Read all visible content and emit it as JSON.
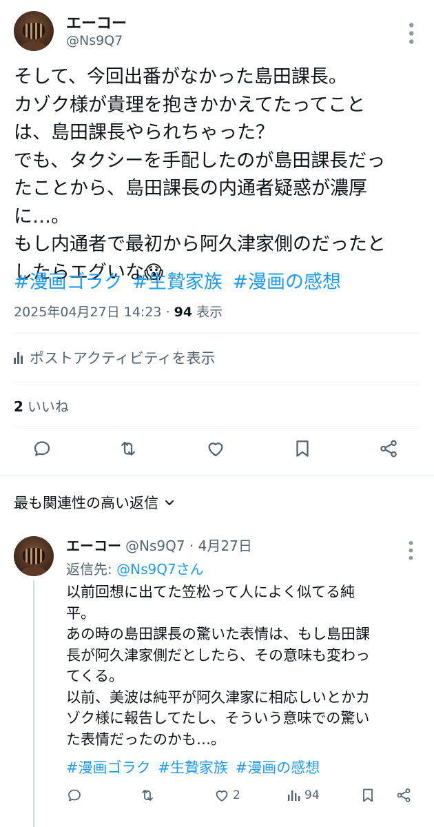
{
  "post": {
    "display_name": "エーコー",
    "handle": "@Ns9Q7",
    "text_lines": [
      "そして、今回出番がなかった島田課長。",
      "カゾク様が貴理を抱きかかえてたってこと",
      "は、島田課長やられちゃった？",
      "でも、タクシーを手配したのが島田課長だっ",
      "たことから、島田課長の内通者疑惑が濃厚",
      "に…。",
      "もし内通者で最初から阿久津家側のだったと",
      "したらエグいな😱"
    ],
    "hashtags": [
      "#漫画ゴラク",
      "#生贄家族",
      "#漫画の感想"
    ],
    "timestamp": "2025年04月27日 14:23",
    "separator": "·",
    "views_count": "94",
    "views_label": "表示",
    "activity_label": "ポストアクティビティを表示",
    "likes_count": "2",
    "likes_label": "いいね"
  },
  "replies_header": {
    "label": "最も関連性の高い返信"
  },
  "reply": {
    "display_name": "エーコー",
    "meta": "@Ns9Q7 · 4月27日",
    "reply_to_prefix": "返信先: ",
    "reply_to_handle": "@Ns9Q7さん",
    "text_lines": [
      "以前回想に出てた笠松って人によく似てる純",
      "平。",
      "あの時の島田課長の驚いた表情は、もし島田課",
      "長が阿久津家側だとしたら、その意味も変わっ",
      "てくる。",
      "以前、美波は純平が阿久津家に相応しいとかカ",
      "ゾク様に報告してたし、そういう意味での驚い",
      "た表情だったのかも…。"
    ],
    "hashtags": [
      "#漫画ゴラク",
      "#生贄家族",
      "#漫画の感想"
    ],
    "likes_count": "2",
    "views_count": "94"
  },
  "icons": {
    "reply": "reply-icon",
    "repost": "repost-icon",
    "like": "heart-icon",
    "bookmark": "bookmark-icon",
    "share": "share-icon",
    "analytics": "analytics-icon",
    "more": "more-icon",
    "chevron": "chevron-down-icon"
  },
  "colors": {
    "link": "#1d9bf0",
    "secondary_text": "#536471",
    "primary_text": "#0f1419",
    "divider": "#eff3f4"
  }
}
